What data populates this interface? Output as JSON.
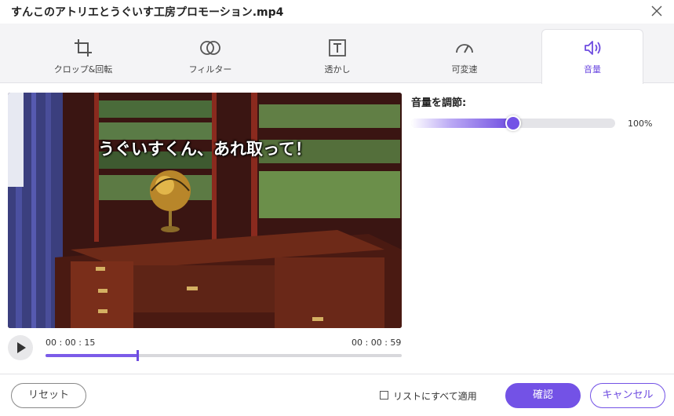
{
  "window": {
    "title": "すんこのアトリエとうぐいす工房プロモーション.mp4"
  },
  "tabs": [
    {
      "label": "クロップ&回転",
      "icon": "crop-rotate-icon"
    },
    {
      "label": "フィルター",
      "icon": "filter-icon"
    },
    {
      "label": "透かし",
      "icon": "watermark-icon"
    },
    {
      "label": "可変速",
      "icon": "speed-gauge-icon"
    },
    {
      "label": "音量",
      "icon": "speaker-volume-icon",
      "active": true
    }
  ],
  "player": {
    "subtitle": "うぐいすくん、あれ取って！",
    "current_time": "00 : 00 : 15",
    "total_time": "00 : 00 : 59",
    "progress": 0.258
  },
  "volume": {
    "label": "音量を調節:",
    "value_text": "100%",
    "level": 0.5
  },
  "footer": {
    "reset_label": "リセット",
    "apply_all_label": "リストにすべて適用",
    "apply_all_checked": false,
    "confirm_label": "確認",
    "cancel_label": "キャンセル"
  },
  "colors": {
    "accent": "#6d4be0"
  }
}
